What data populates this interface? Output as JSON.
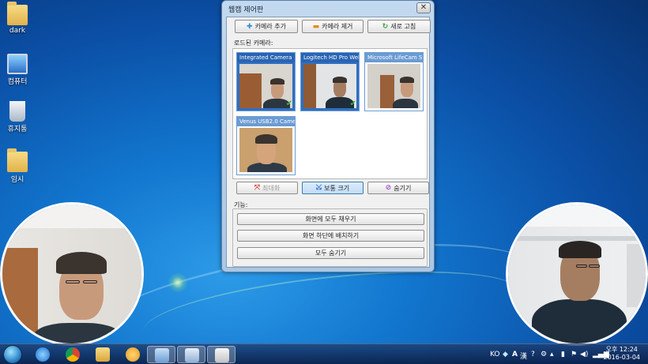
{
  "desktop": {
    "icons": [
      {
        "label": "dark"
      },
      {
        "label": "컴퓨터"
      },
      {
        "label": "휴지통"
      },
      {
        "label": "임시"
      }
    ]
  },
  "window": {
    "title": "웹캠 제어판",
    "close": "✕",
    "toolbar": {
      "add_camera": "카메라 추가",
      "remove_camera": "카메라 제거",
      "refresh": "새로 고침"
    },
    "loaded_cameras_label": "로드된 카메라:",
    "cameras": [
      {
        "name": "Integrated Camera",
        "checked": true
      },
      {
        "name": "Logitech HD Pro Webc...",
        "checked": true
      },
      {
        "name": "Microsoft LifeCam Stu...",
        "checked": false
      },
      {
        "name": "Venus USB2.0 Camera",
        "checked": false
      }
    ],
    "view_buttons": {
      "maximize": "최대화",
      "normal_size": "보통 크기",
      "hide": "숨기기"
    },
    "functions_label": "기능:",
    "functions": {
      "fill_screen": "화면에 모두 채우기",
      "arrange_bottom": "화면 하단에 배치하기",
      "hide_all": "모두 숨기기"
    }
  },
  "taskbar": {
    "tray": {
      "lang": "KO",
      "ime_a": "A",
      "ime_han": "漢"
    },
    "clock": {
      "time": "오후 12:24",
      "date": "2016-03-04"
    }
  }
}
